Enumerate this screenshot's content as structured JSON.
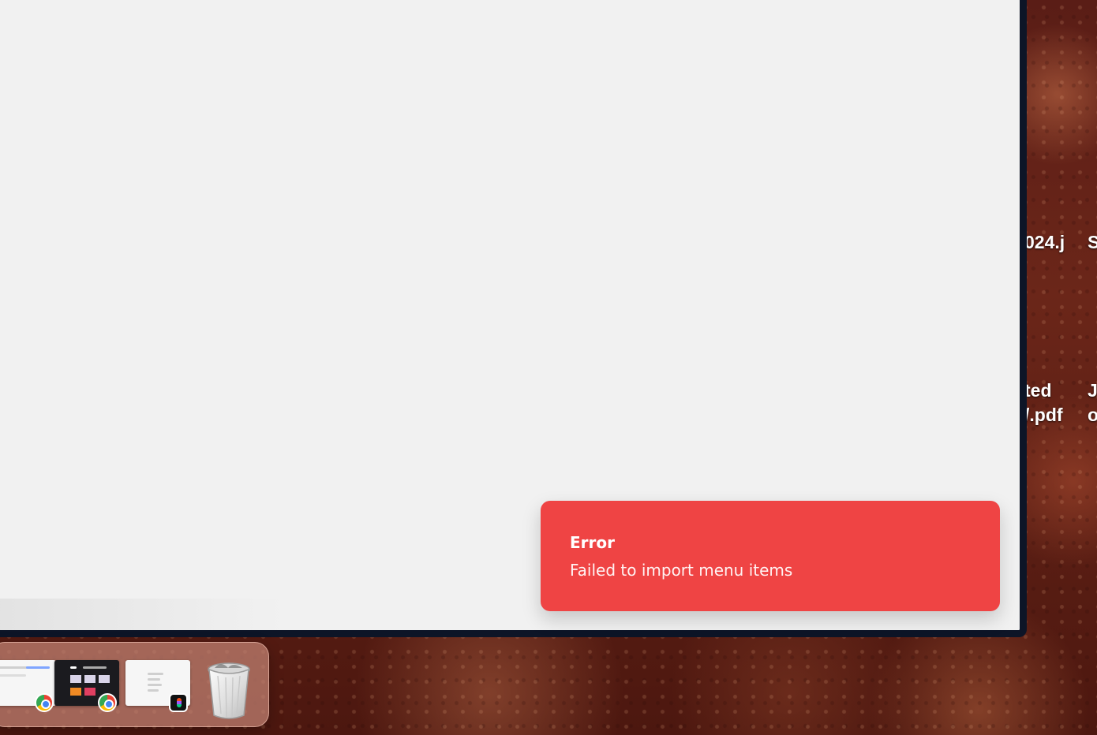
{
  "toast": {
    "title": "Error",
    "message": "Failed to import menu items",
    "color": "#ef4444"
  },
  "desktop": {
    "labels": [
      "024.j",
      "S",
      "ted",
      "J",
      "/.pdf",
      "o"
    ]
  },
  "dock": {
    "items": [
      {
        "name": "chrome-window-thumbnail",
        "badge_icon": "chrome-icon"
      },
      {
        "name": "chrome-dark-window-thumbnail",
        "badge_icon": "chrome-icon"
      },
      {
        "name": "figma-window-thumbnail",
        "badge_icon": "figma-icon"
      },
      {
        "name": "trash",
        "icon": "trash-icon"
      }
    ]
  }
}
